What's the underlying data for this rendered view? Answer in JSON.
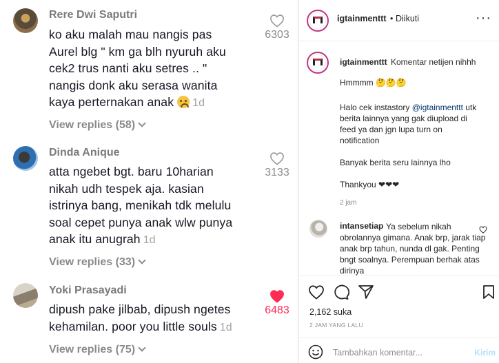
{
  "tiktok": {
    "comments": [
      {
        "username": "Rere Dwi Saputri",
        "lines": [
          "ko aku malah mau nangis pas",
          "Aurel blg \" km ga blh nyuruh aku",
          "cek2 trus nanti aku setres .. \"",
          "nangis donk aku serasa wanita",
          "kaya perternakan anak"
        ],
        "time": "1d",
        "likes": "6303",
        "liked": false,
        "view_replies": "View replies (58)"
      },
      {
        "username": "Dinda Anique",
        "lines": [
          "atta ngebet bgt. baru 10harian",
          "nikah udh tespek aja. kasian",
          "istrinya bang, menikah tdk melulu",
          "soal cepet punya anak wlw punya",
          "anak itu anugrah"
        ],
        "time": "1d",
        "likes": "3133",
        "liked": false,
        "view_replies": "View replies (33)"
      },
      {
        "username": "Yoki Prasayadi",
        "lines": [
          "dipush pake jilbab, dipush ngetes",
          "kehamilan. poor you little souls"
        ],
        "time": "1d",
        "likes": "6483",
        "liked": true,
        "view_replies": "View replies (75)"
      }
    ],
    "colors": {
      "liked_heart": "#fe2c55",
      "text": "#161823",
      "muted": "#8a8a8a"
    }
  },
  "instagram": {
    "handle": "igtainmenttt",
    "separator": "•",
    "follow_status": "Diikuti",
    "more_icon": "more-options-icon",
    "caption": {
      "username": "igtainmenttt",
      "first_line": "Komentar netijen nihhh",
      "hmm": "Hmmmm 🤔🤔🤔",
      "promo_prefix": "Halo cek instastory ",
      "promo_mention": "@igtainmenttt",
      "promo_rest_1": " utk",
      "promo_lines": [
        "berita lainnya yang gak diupload di",
        "feed ya dan jgn lupa turn on",
        "notification"
      ],
      "more_news": "Banyak berita seru lainnya lho",
      "thanks": "Thankyou ❤❤❤",
      "time": "2 jam"
    },
    "reply": {
      "username": "intansetiap",
      "text": "Ya sebelum nikah obrolannya gimana. Anak brp, jarak tiap anak brp tahun, nunda dl gak. Penting bngt soalnya. Perempuan berhak atas dirinya"
    },
    "likes": "2,162 suka",
    "post_time": "2 JAM YANG LALU",
    "comment_placeholder": "Tambahkan komentar...",
    "send_label": "Kirim",
    "colors": {
      "border": "#dbdbdb",
      "mention": "#00376b",
      "send_disabled": "#b2dffc"
    }
  }
}
